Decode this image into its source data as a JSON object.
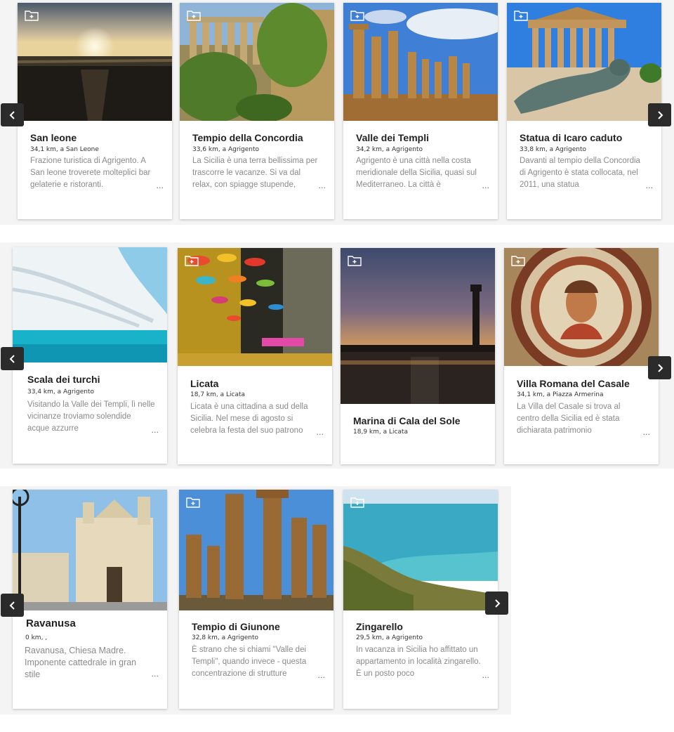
{
  "rows": [
    {
      "cards": [
        {
          "title": "San leone",
          "meta": "34,1 km, a San Leone",
          "desc": "Frazione turistica di Agrigento. A San leone troverete molteplici bar gelaterie e ristoranti.",
          "more": "..."
        },
        {
          "title": "Tempio della Concordia",
          "meta": "33,6 km, a Agrigento",
          "desc": "La Sicilia è una terra bellissima per trascorre le vacanze. Si va dal relax, con spiagge stupende,",
          "more": "..."
        },
        {
          "title": "Valle dei Templi",
          "meta": "34,2 km, a Agrigento",
          "desc": "Agrigento è una città nella costa meridionale della Sicilia, quasi sul Mediterraneo. La città è",
          "more": "..."
        },
        {
          "title": "Statua di Icaro caduto",
          "meta": "33,8 km, a Agrigento",
          "desc": "Davanti al tempio della Concordia di Agrigento è stata collocata, nel 2011, una statua",
          "more": "..."
        }
      ]
    },
    {
      "cards": [
        {
          "title": "Scala dei turchi",
          "meta": "33,4 km, a Agrigento",
          "desc": "Visitando la Valle dei Templi,  lì nelle vicinanze troviamo  solendide acque azzurre",
          "more": "..."
        },
        {
          "title": "Licata",
          "meta": "18,7 km, a Licata",
          "desc": "Licata è una cittadina a sud della Sicilia. Nel mese di agosto si celebra la festa del suo patrono",
          "more": "..."
        },
        {
          "title": "Marina di Cala del Sole",
          "meta": "18,9 km, a Licata",
          "desc": "",
          "more": ""
        },
        {
          "title": "Villa Romana del Casale",
          "meta": "34,1 km, a Piazza Armerina",
          "desc": "La Villa del Casale si trova al centro della Sicilia ed è stata dichiarata patrimonio",
          "more": "..."
        }
      ]
    },
    {
      "cards": [
        {
          "title": "Ravanusa",
          "meta": "0  km,  ,",
          "desc": "Ravanusa, Chiesa Madre. Imponente cattedrale in gran stile",
          "more": "..."
        },
        {
          "title": "Tempio di Giunone",
          "meta": "32,8 km, a Agrigento",
          "desc": "È strano che si chiami \"Valle dei Templi\", quando invece - questa concentrazione di strutture",
          "more": "..."
        },
        {
          "title": "Zingarello",
          "meta": "29,5 km, a Agrigento",
          "desc": "In vacanza in Sicilia ho affittato un appartamento in località zingarello. È un posto poco",
          "more": "..."
        }
      ]
    }
  ],
  "icons": {
    "folder": "folder-add-icon",
    "prev": "chevron-left-icon",
    "next": "chevron-right-icon"
  },
  "colors": {
    "nav_bg": "#2b2b2b",
    "title": "#222222",
    "desc": "#8a8a8a"
  }
}
